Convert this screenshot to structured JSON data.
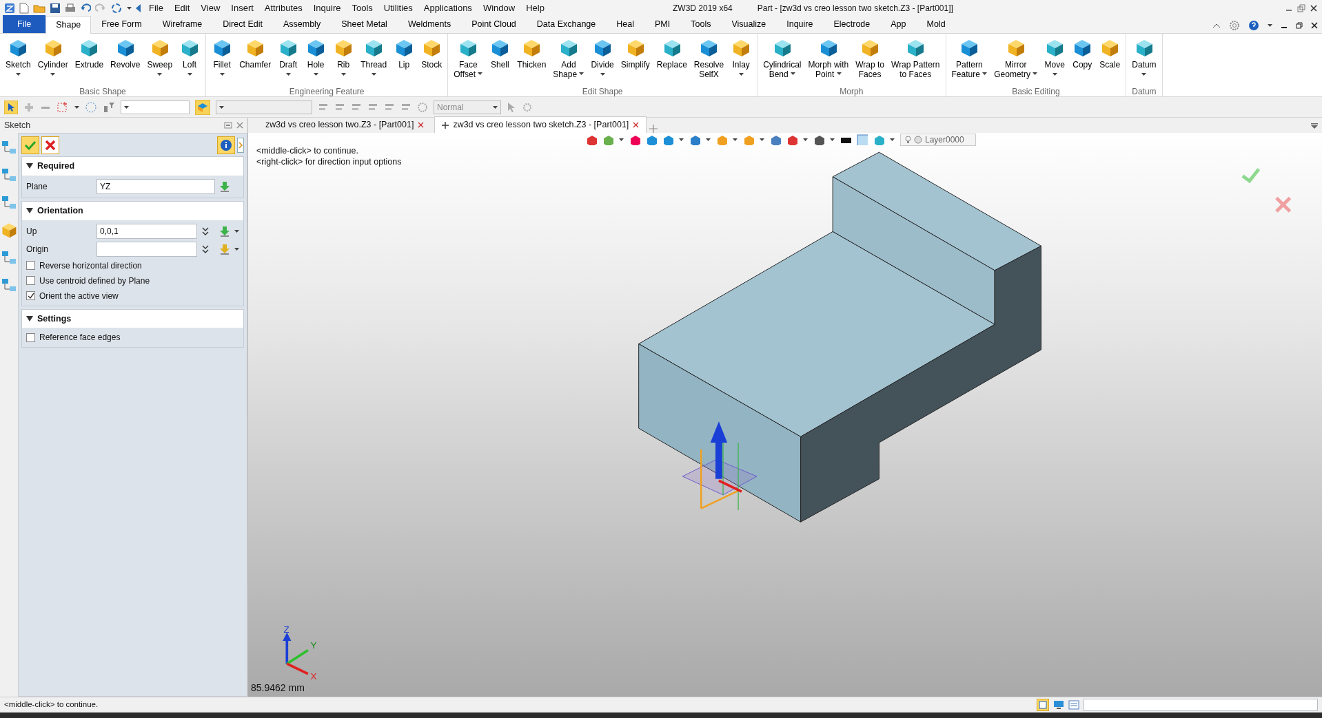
{
  "title_bar": {
    "app_name": "ZW3D 2019  x64",
    "document_title": "Part - [zw3d vs creo lesson two sketch.Z3 - [Part001]]"
  },
  "menu": [
    "File",
    "Edit",
    "View",
    "Insert",
    "Attributes",
    "Inquire",
    "Tools",
    "Utilities",
    "Applications",
    "Window",
    "Help"
  ],
  "ribbon_tabs": [
    {
      "label": "File",
      "kind": "file",
      "selected": false
    },
    {
      "label": "Shape",
      "kind": "tab",
      "selected": true
    },
    {
      "label": "Free Form",
      "kind": "tab",
      "selected": false
    },
    {
      "label": "Wireframe",
      "kind": "tab",
      "selected": false
    },
    {
      "label": "Direct Edit",
      "kind": "tab",
      "selected": false
    },
    {
      "label": "Assembly",
      "kind": "tab",
      "selected": false
    },
    {
      "label": "Sheet Metal",
      "kind": "tab",
      "selected": false
    },
    {
      "label": "Weldments",
      "kind": "tab",
      "selected": false
    },
    {
      "label": "Point Cloud",
      "kind": "tab",
      "selected": false
    },
    {
      "label": "Data Exchange",
      "kind": "tab",
      "selected": false
    },
    {
      "label": "Heal",
      "kind": "tab",
      "selected": false
    },
    {
      "label": "PMI",
      "kind": "tab",
      "selected": false
    },
    {
      "label": "Tools",
      "kind": "tab",
      "selected": false
    },
    {
      "label": "Visualize",
      "kind": "tab",
      "selected": false
    },
    {
      "label": "Inquire",
      "kind": "tab",
      "selected": false
    },
    {
      "label": "Electrode",
      "kind": "tab",
      "selected": false
    },
    {
      "label": "App",
      "kind": "tab",
      "selected": false
    },
    {
      "label": "Mold",
      "kind": "tab",
      "selected": false
    }
  ],
  "ribbon_groups": [
    {
      "label": "Basic Shape",
      "buttons": [
        {
          "lines": [
            "Sketch"
          ],
          "dropdown": true
        },
        {
          "lines": [
            "Cylinder"
          ],
          "dropdown": true
        },
        {
          "lines": [
            "Extrude"
          ],
          "dropdown": false
        },
        {
          "lines": [
            "Revolve"
          ],
          "dropdown": false
        },
        {
          "lines": [
            "Sweep"
          ],
          "dropdown": true
        },
        {
          "lines": [
            "Loft"
          ],
          "dropdown": true
        }
      ]
    },
    {
      "label": "Engineering Feature",
      "buttons": [
        {
          "lines": [
            "Fillet"
          ],
          "dropdown": true
        },
        {
          "lines": [
            "Chamfer"
          ],
          "dropdown": false
        },
        {
          "lines": [
            "Draft"
          ],
          "dropdown": true
        },
        {
          "lines": [
            "Hole"
          ],
          "dropdown": true
        },
        {
          "lines": [
            "Rib"
          ],
          "dropdown": true
        },
        {
          "lines": [
            "Thread"
          ],
          "dropdown": true
        },
        {
          "lines": [
            "Lip"
          ],
          "dropdown": false
        },
        {
          "lines": [
            "Stock"
          ],
          "dropdown": false
        }
      ]
    },
    {
      "label": "Edit Shape",
      "buttons": [
        {
          "lines": [
            "Face",
            "Offset"
          ],
          "dropdown": true
        },
        {
          "lines": [
            "Shell"
          ],
          "dropdown": false
        },
        {
          "lines": [
            "Thicken"
          ],
          "dropdown": false
        },
        {
          "lines": [
            "Add",
            "Shape"
          ],
          "dropdown": true
        },
        {
          "lines": [
            "Divide"
          ],
          "dropdown": true
        },
        {
          "lines": [
            "Simplify"
          ],
          "dropdown": false
        },
        {
          "lines": [
            "Replace"
          ],
          "dropdown": false
        },
        {
          "lines": [
            "Resolve",
            "SelfX"
          ],
          "dropdown": false
        },
        {
          "lines": [
            "Inlay"
          ],
          "dropdown": true
        }
      ]
    },
    {
      "label": "Morph",
      "buttons": [
        {
          "lines": [
            "Cylindrical",
            "Bend"
          ],
          "dropdown": true
        },
        {
          "lines": [
            "Morph with",
            "Point"
          ],
          "dropdown": true
        },
        {
          "lines": [
            "Wrap to",
            "Faces"
          ],
          "dropdown": false
        },
        {
          "lines": [
            "Wrap Pattern",
            "to Faces"
          ],
          "dropdown": false
        }
      ]
    },
    {
      "label": "Basic Editing",
      "buttons": [
        {
          "lines": [
            "Pattern",
            "Feature"
          ],
          "dropdown": true
        },
        {
          "lines": [
            "Mirror",
            "Geometry"
          ],
          "dropdown": true
        },
        {
          "lines": [
            "Move"
          ],
          "dropdown": true
        },
        {
          "lines": [
            "Copy"
          ],
          "dropdown": false
        },
        {
          "lines": [
            "Scale"
          ],
          "dropdown": false
        }
      ]
    },
    {
      "label": "Datum",
      "buttons": [
        {
          "lines": [
            "Datum"
          ],
          "dropdown": true
        }
      ]
    }
  ],
  "toolbar": {
    "filter_value": "Normal"
  },
  "panel": {
    "title": "Sketch",
    "sections": [
      {
        "title": "Required",
        "expanded": true,
        "rows": [
          {
            "kind": "field",
            "label": "Plane",
            "value": "YZ"
          }
        ]
      },
      {
        "title": "Orientation",
        "expanded": true,
        "rows": [
          {
            "kind": "vector",
            "label": "Up",
            "value": "0,0,1"
          },
          {
            "kind": "vector",
            "label": "Origin"
          },
          {
            "kind": "checkbox",
            "label": "Reverse horizontal direction",
            "checked": false
          },
          {
            "kind": "checkbox",
            "label": "Use centroid defined by Plane",
            "checked": false
          },
          {
            "kind": "checkbox",
            "label": "Orient the active view",
            "checked": true
          }
        ]
      },
      {
        "title": "Settings",
        "expanded": true,
        "rows": [
          {
            "kind": "checkbox",
            "label": "Reference face edges",
            "checked": false
          }
        ]
      }
    ]
  },
  "doc_tabs": [
    {
      "label": "zw3d vs creo lesson two.Z3 - [Part001]",
      "selected": false
    },
    {
      "label": "zw3d vs creo lesson two sketch.Z3 - [Part001]",
      "selected": true
    }
  ],
  "viewport": {
    "prompts": [
      "<middle-click> to continue.",
      "<right-click> for direction input options"
    ],
    "layer": "Layer0000",
    "measurement": "85.9462 mm",
    "axes": [
      "Z",
      "Y",
      "X"
    ]
  },
  "status_bar": {
    "message": "<middle-click> to continue."
  }
}
